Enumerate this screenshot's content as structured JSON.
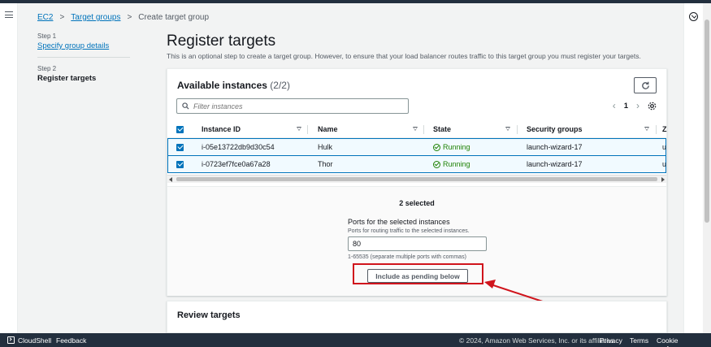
{
  "breadcrumb": {
    "items": [
      "EC2",
      "Target groups"
    ],
    "current": "Create target group"
  },
  "steps": [
    {
      "label": "Step 1",
      "title": "Specify group details"
    },
    {
      "label": "Step 2",
      "title": "Register targets"
    }
  ],
  "page": {
    "title": "Register targets",
    "description": "This is an optional step to create a target group. However, to ensure that your load balancer routes traffic to this target group you must register your targets."
  },
  "instances": {
    "title": "Available instances",
    "count": "(2/2)",
    "filter_placeholder": "Filter instances",
    "page_number": "1",
    "columns": [
      "Instance ID",
      "Name",
      "State",
      "Security groups"
    ],
    "rows": [
      {
        "instance_id": "i-05e13722db9d30c54",
        "name": "Hulk",
        "state": "Running",
        "security_groups": "launch-wizard-17"
      },
      {
        "instance_id": "i-0723ef7fce0a67a28",
        "name": "Thor",
        "state": "Running",
        "security_groups": "launch-wizard-17"
      }
    ],
    "clipped_col_header": "Z",
    "clipped_col_value": "u"
  },
  "selection": {
    "selected_text": "2 selected",
    "ports_label": "Ports for the selected instances",
    "ports_sublabel": "Ports for routing traffic to the selected instances.",
    "ports_value": "80",
    "ports_hint": "1-65535 (separate multiple ports with commas)",
    "include_button": "Include as pending below"
  },
  "review": {
    "title": "Review targets"
  },
  "footer": {
    "cloudshell": "CloudShell",
    "feedback": "Feedback",
    "copyright": "© 2024, Amazon Web Services, Inc. or its affiliates.",
    "privacy": "Privacy",
    "terms": "Terms",
    "cookies": "Cookie preferences"
  },
  "colors": {
    "link": "#0073bb",
    "success": "#1d8102",
    "highlight": "#d0141c",
    "nav_dark": "#232f3e"
  }
}
